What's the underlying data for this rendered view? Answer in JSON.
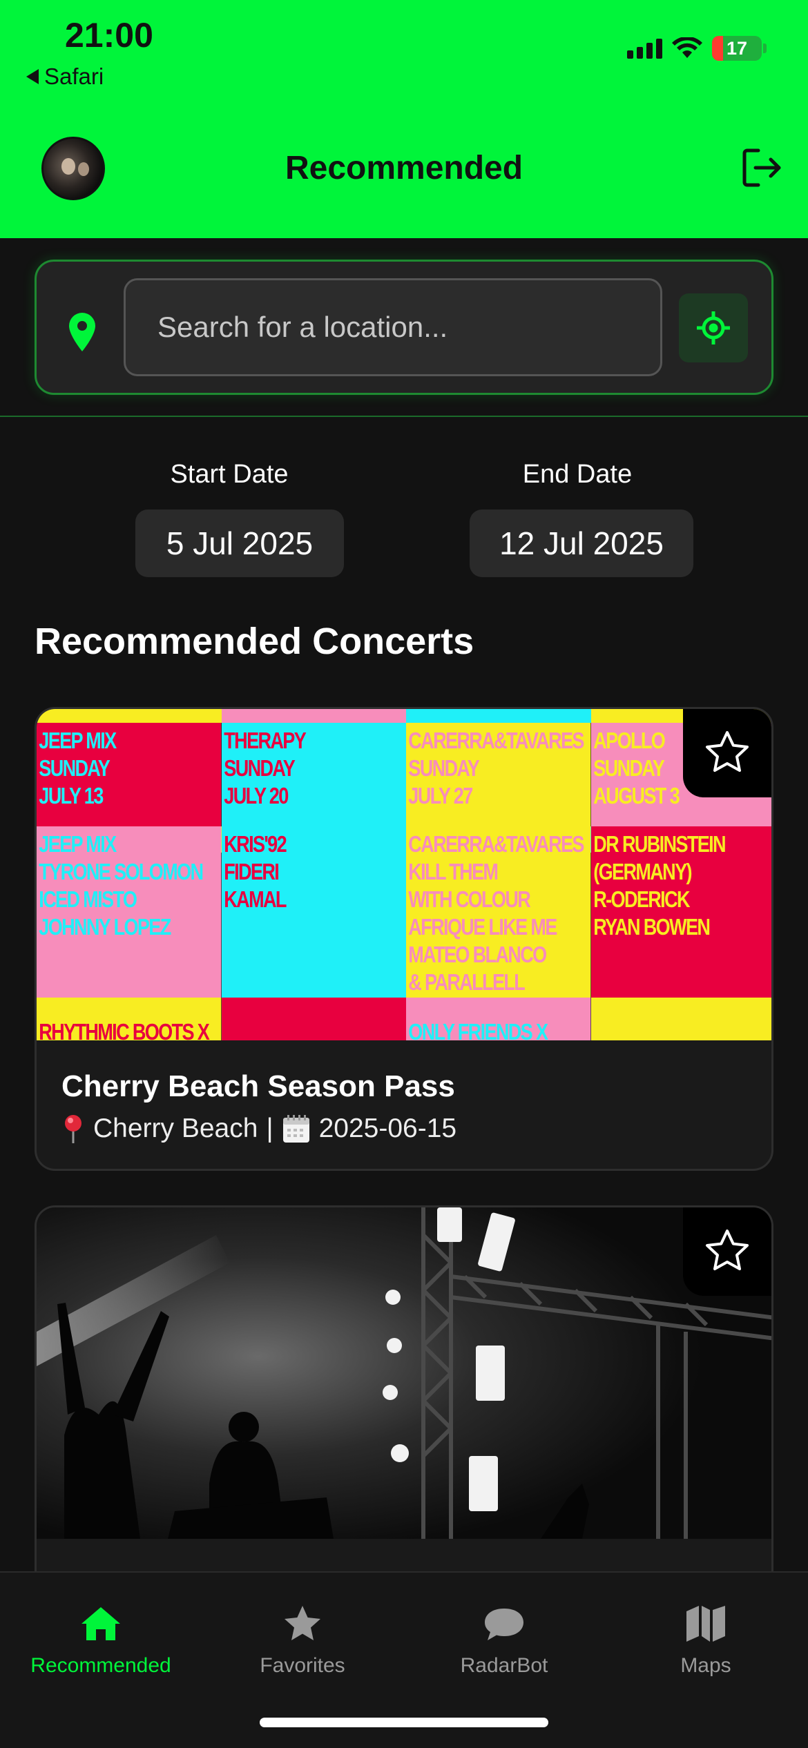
{
  "status_bar": {
    "time": "21:00",
    "back_app": "Safari",
    "battery": "17"
  },
  "header": {
    "title": "Recommended"
  },
  "location": {
    "placeholder": "Search for a location..."
  },
  "dates": {
    "start_label": "Start Date",
    "start_value": "5 Jul 2025",
    "end_label": "End Date",
    "end_value": "12 Jul 2025"
  },
  "section_title": "Recommended Concerts",
  "concerts": [
    {
      "title": "Cherry Beach Season Pass",
      "location": "Cherry Beach",
      "separator": "|",
      "date": "2025-06-15",
      "poster": [
        [
          "JEEP MIX\nSUNDAY\nJULY 13",
          "THERAPY\nSUNDAY\nJULY 20",
          "CARERRA&TAVARES\nSUNDAY\nJULY 27",
          "APOLLO\nSUNDAY\nAUGUST 3"
        ],
        [
          "JEEP MIX\nTYRONE SOLOMON\nICED MISTO\nJOHNNY LOPEZ",
          "KRIS'92\nFIDERI\nKAMAL",
          "CARERRA&TAVARES\nKILL THEM\nWITH COLOUR\nAFRIQUE LIKE ME\nMATEO BLANCO\n& PARALLELL",
          "DR RUBINSTEIN\n(GERMANY)\nR-ODERICK\nRYAN BOWEN"
        ],
        [
          "RHYTHMIC BOOTS X",
          "",
          "ONLY FRIENDS X",
          ""
        ]
      ]
    },
    {
      "title": "",
      "location": "",
      "separator": "",
      "date": ""
    }
  ],
  "tabs": [
    {
      "label": "Recommended",
      "icon": "home-icon",
      "active": true
    },
    {
      "label": "Favorites",
      "icon": "star-icon",
      "active": false
    },
    {
      "label": "RadarBot",
      "icon": "chat-bubble-icon",
      "active": false
    },
    {
      "label": "Maps",
      "icon": "map-icon",
      "active": false
    }
  ],
  "colors": {
    "accent": "#00f53a",
    "background": "#121212",
    "card": "#1a1a1a"
  }
}
